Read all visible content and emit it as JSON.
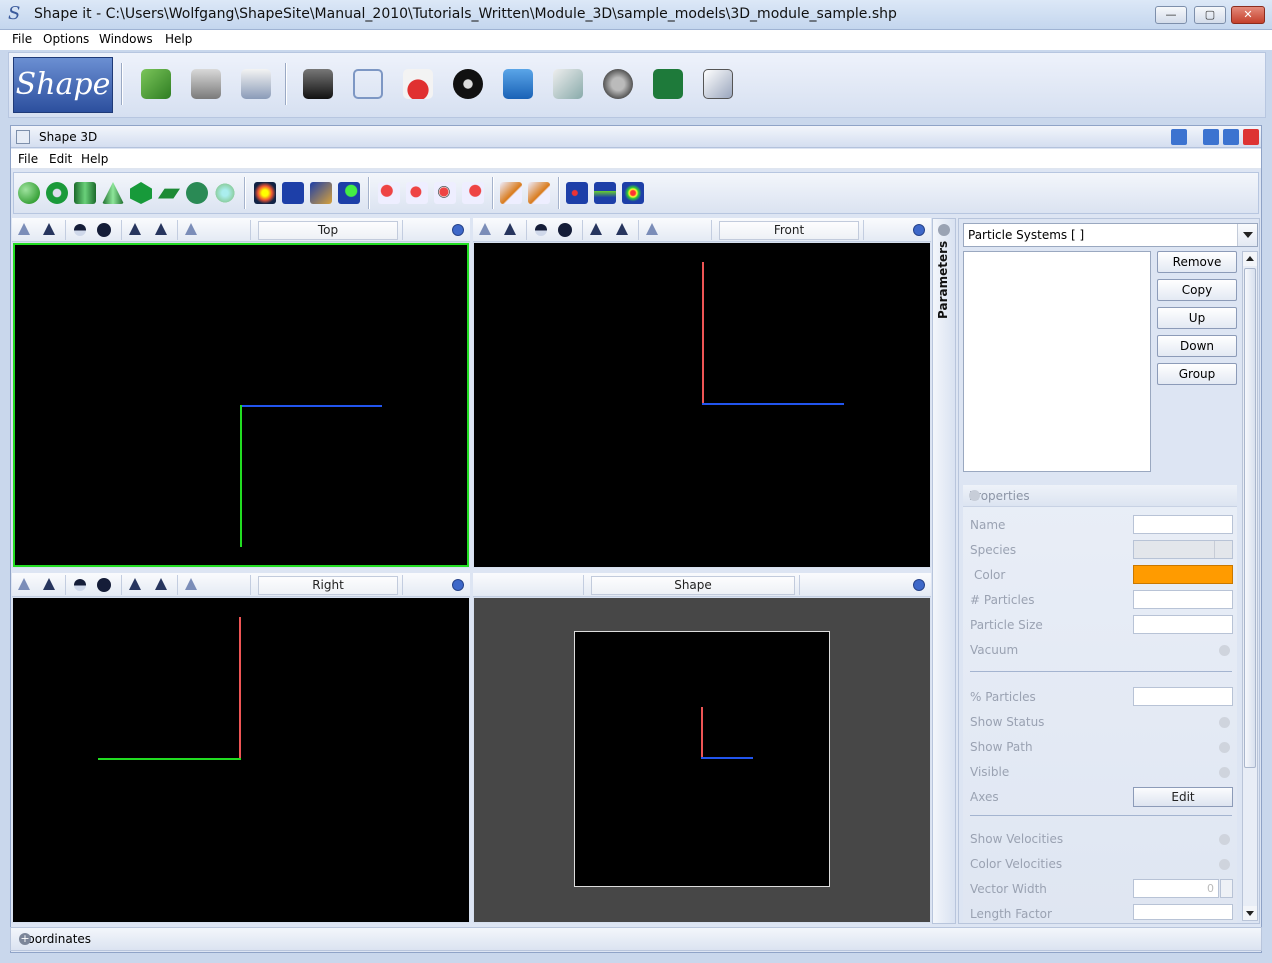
{
  "window": {
    "title": "Shape it - C:\\Users\\Wolfgang\\ShapeSite\\Manual_2010\\Tutorials_Written\\Module_3D\\sample_models\\3D_module_sample.shp",
    "app_icon": "S",
    "minimize": "—",
    "maximize": "▢",
    "close": "✕"
  },
  "main_menu": [
    "File",
    "Options",
    "Windows",
    "Help"
  ],
  "main_toolbar": {
    "logo_text": "Shape",
    "icons": [
      "open-folder-icon",
      "save-icon",
      "document-icon",
      "camera-icon",
      "cube-icon",
      "flask-icon",
      "dial-icon",
      "waveform-icon",
      "figure-icon",
      "film-reel-icon",
      "formula-icon",
      "page-icon"
    ]
  },
  "inner_frame": {
    "title": "Shape 3D",
    "menu": [
      "File",
      "Edit",
      "Help"
    ]
  },
  "viewports": {
    "top": {
      "label": "Top"
    },
    "front": {
      "label": "Front"
    },
    "right": {
      "label": "Right"
    },
    "shape": {
      "label": "Shape"
    }
  },
  "colors": {
    "axis_x": "#2255ee",
    "axis_y": "#22dd22",
    "axis_z": "#ee5555",
    "active_border": "#22dd22",
    "particle_color": "#ff9b00"
  },
  "sidebar": {
    "strip_label": "Parameters",
    "combo_value": "Particle Systems [ ]",
    "buttons": [
      "Remove",
      "Copy",
      "Up",
      "Down",
      "Group"
    ]
  },
  "properties": {
    "header": "Properties",
    "fields": {
      "name": "Name",
      "species": "Species",
      "color": "Color",
      "particles": "# Particles",
      "particle_size": "Particle Size",
      "vacuum": "Vacuum",
      "pct_particles": "% Particles",
      "show_status": "Show Status",
      "show_path": "Show Path",
      "visible": "Visible",
      "axes": "Axes",
      "axes_button": "Edit",
      "show_velocities": "Show Velocities",
      "color_velocities": "Color Velocities",
      "vector_width": "Vector Width",
      "vector_width_value": "0",
      "length_factor": "Length Factor"
    }
  },
  "status_bar": {
    "label": "Coordinates",
    "expand": "+"
  }
}
